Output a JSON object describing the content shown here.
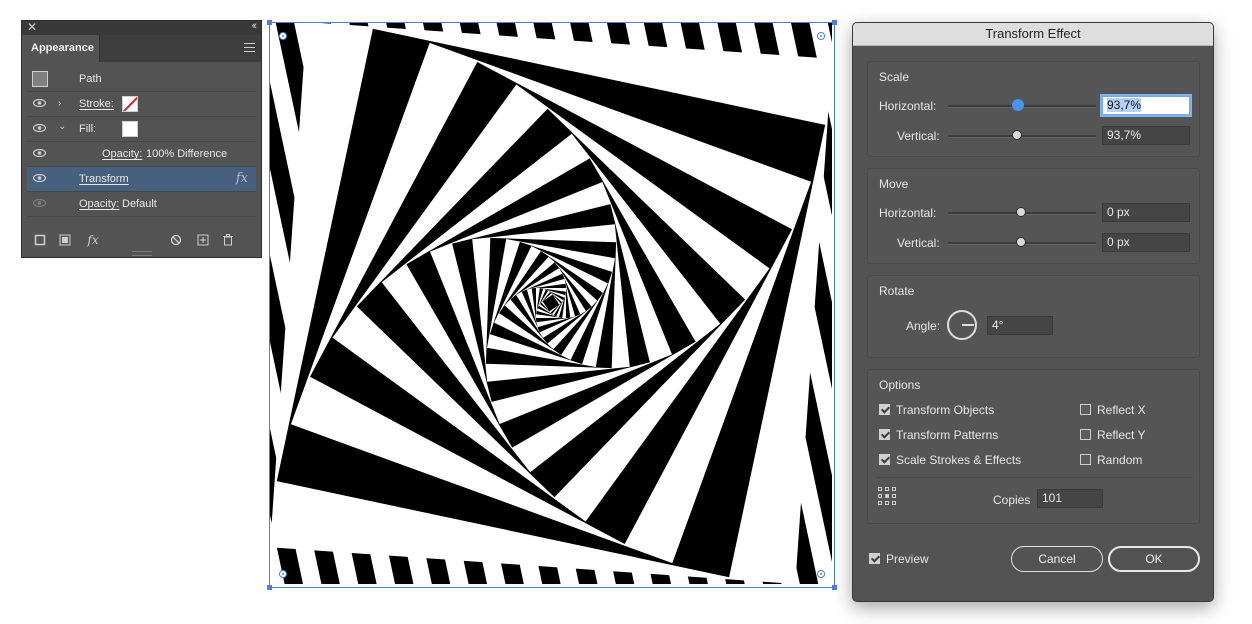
{
  "appearance_panel": {
    "tab_label": "Appearance",
    "rows": [
      {
        "label": "Path"
      },
      {
        "label": "Stroke:"
      },
      {
        "label": "Fill:"
      },
      {
        "label": "Opacity:",
        "value": "100% Difference"
      },
      {
        "label": "Transform"
      },
      {
        "label": "Opacity:",
        "value": "Default"
      }
    ],
    "fx_glyph": "fx"
  },
  "dialog": {
    "title": "Transform Effect",
    "scale": {
      "title": "Scale",
      "horizontal_label": "Horizontal:",
      "horizontal_value": "93,7%",
      "vertical_label": "Vertical:",
      "vertical_value": "93,7%"
    },
    "move": {
      "title": "Move",
      "horizontal_label": "Horizontal:",
      "horizontal_value": "0 px",
      "vertical_label": "Vertical:",
      "vertical_value": "0 px"
    },
    "rotate": {
      "title": "Rotate",
      "angle_label": "Angle:",
      "angle_value": "4°"
    },
    "options": {
      "title": "Options",
      "transform_objects": "Transform Objects",
      "transform_patterns": "Transform Patterns",
      "scale_strokes": "Scale Strokes & Effects",
      "reflect_x": "Reflect X",
      "reflect_y": "Reflect Y",
      "random": "Random",
      "copies_label": "Copies",
      "copies_value": "101"
    },
    "preview_label": "Preview",
    "cancel_label": "Cancel",
    "ok_label": "OK"
  },
  "colors": {
    "accent": "#4a95f0",
    "selection": "#4a7fdc",
    "panel_bg": "#535353"
  }
}
